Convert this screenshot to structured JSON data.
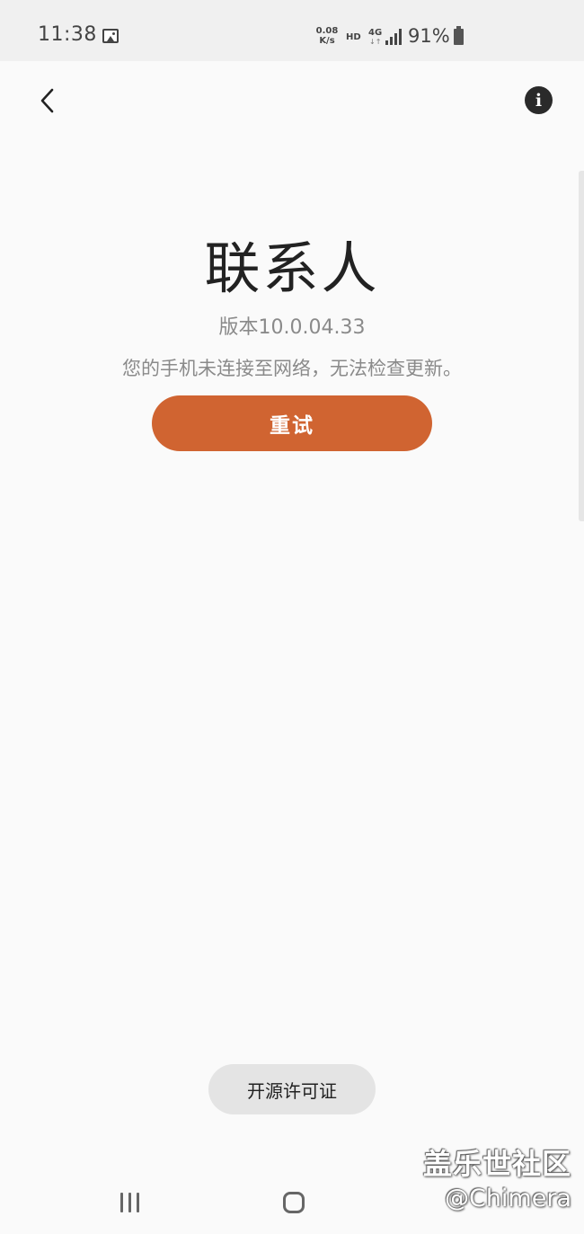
{
  "status_bar": {
    "time": "11:38",
    "net_speed_value": "0.08",
    "net_speed_unit": "K/s",
    "hd": "HD",
    "network": "4G",
    "network_arrows": "↓↑",
    "battery": "91%",
    "icons": [
      "gallery-icon",
      "signal-icon",
      "battery-icon"
    ]
  },
  "toolbar": {
    "back_icon": "chevron-left-icon",
    "info_icon": "info-icon",
    "info_glyph": "i"
  },
  "main": {
    "app_name": "联系人",
    "version": "版本10.0.04.33",
    "error_message": "您的手机未连接至网络，无法检查更新。",
    "retry_label": "重试",
    "license_label": "开源许可证"
  },
  "colors": {
    "accent": "#d06431",
    "background": "#fafafa",
    "status_bar": "#f0f0f0"
  },
  "nav_bar": {
    "icons": [
      "recents-icon",
      "home-icon"
    ]
  },
  "watermark": {
    "line1": "盖乐世社区",
    "line2": "@Chimera"
  }
}
